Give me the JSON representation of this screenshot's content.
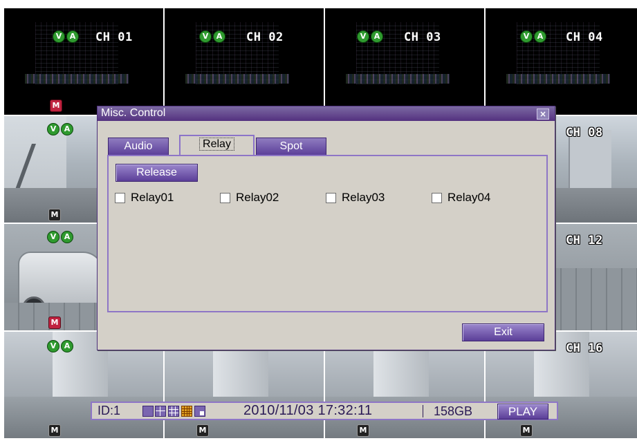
{
  "channels": [
    {
      "label": "CH 01",
      "motion": "M"
    },
    {
      "label": "CH 02",
      "motion": "M"
    },
    {
      "label": "CH 03",
      "motion": "M"
    },
    {
      "label": "CH 04",
      "motion": "M"
    },
    {
      "label": "CH 08"
    },
    {
      "label": "CH 12"
    },
    {
      "label": "CH 16"
    }
  ],
  "badges": {
    "video": "V",
    "audio": "A",
    "motion": "M"
  },
  "dialog": {
    "title": "Misc. Control",
    "close": "×",
    "tabs": [
      {
        "label": "Audio"
      },
      {
        "label": "Relay",
        "active": true
      },
      {
        "label": "Spot"
      }
    ],
    "release_button": "Release",
    "relays": [
      "Relay01",
      "Relay02",
      "Relay03",
      "Relay04"
    ],
    "exit_button": "Exit"
  },
  "status": {
    "id": "ID:1",
    "datetime": "2010/11/03 17:32:11",
    "storage": "158GB",
    "mode_button": "PLAY"
  },
  "colors": {
    "accent_purple": "#53317f",
    "button_purple": "#5b3e98",
    "panel_gray": "#d4d0c8",
    "indicator_green": "#2f9a2f",
    "motion_red": "#c0223f"
  }
}
